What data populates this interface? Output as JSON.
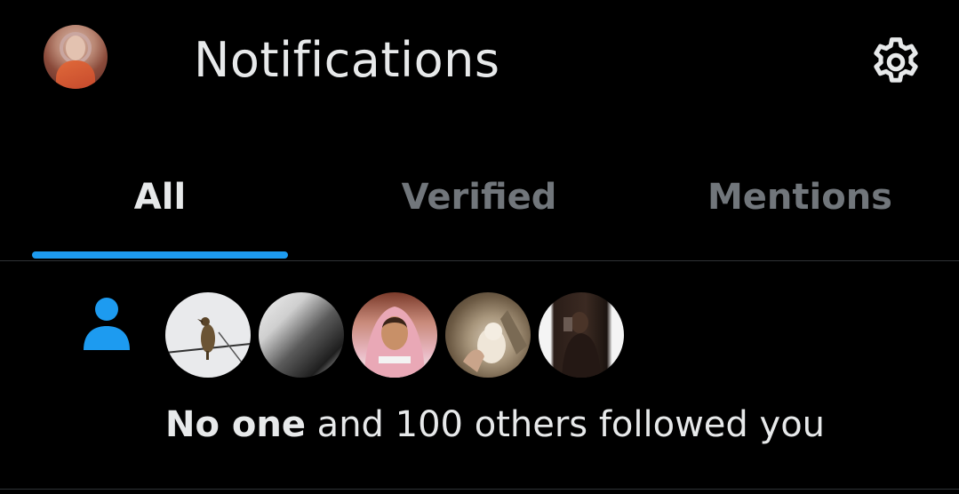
{
  "header": {
    "title": "Notifications",
    "settings_icon": "gear-icon",
    "avatar_icon": "profile-avatar"
  },
  "tabs": [
    {
      "label": "All",
      "active": true
    },
    {
      "label": "Verified",
      "active": false
    },
    {
      "label": "Mentions",
      "active": false
    }
  ],
  "notification": {
    "icon": "person-icon",
    "icon_color": "#1d9bf0",
    "actor": "No one",
    "message": " and 100 others followed you",
    "follower_avatars": [
      "bird-on-wire",
      "woman-portrait",
      "man-in-hoodie",
      "cat-held",
      "person-mirror-selfie"
    ]
  },
  "colors": {
    "background": "#000000",
    "accent": "#1d9bf0",
    "text_primary": "#e7e9ea",
    "text_secondary": "#71767b",
    "divider": "#2f3336"
  }
}
